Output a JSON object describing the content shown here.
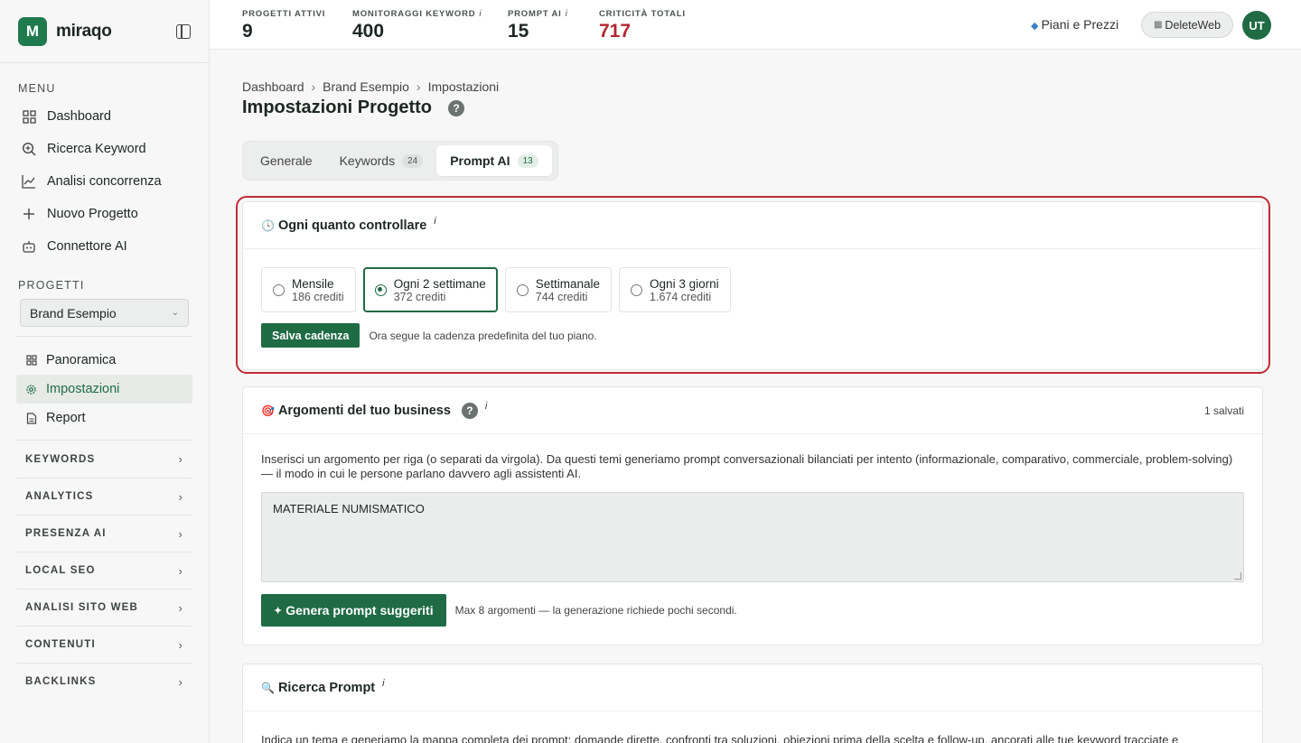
{
  "brand": {
    "logo_letter": "M",
    "name": "miraqo"
  },
  "sidebar": {
    "menu_title": "MENU",
    "menu": [
      {
        "label": "Dashboard",
        "icon": "grid-icon"
      },
      {
        "label": "Ricerca Keyword",
        "icon": "search-plus-icon"
      },
      {
        "label": "Analisi concorrenza",
        "icon": "chart-line-icon"
      },
      {
        "label": "Nuovo Progetto",
        "icon": "plus-icon"
      },
      {
        "label": "Connettore AI",
        "icon": "robot-icon"
      }
    ],
    "projects_title": "PROGETTI",
    "project_select": "Brand Esempio",
    "project_nav": [
      {
        "label": "Panoramica",
        "icon": "grid-small-icon"
      },
      {
        "label": "Impostazioni",
        "icon": "gear-icon",
        "active": true
      },
      {
        "label": "Report",
        "icon": "document-icon"
      }
    ],
    "groups": [
      "KEYWORDS",
      "ANALYTICS",
      "PRESENZA AI",
      "LOCAL SEO",
      "ANALISI SITO WEB",
      "CONTENUTI",
      "BACKLINKS"
    ]
  },
  "topbar": {
    "stats": [
      {
        "label": "PROGETTI ATTIVI",
        "value": "9",
        "info": ""
      },
      {
        "label": "MONITORAGGI KEYWORD",
        "value": "400",
        "info": "i"
      },
      {
        "label": "PROMPT AI",
        "value": "15",
        "info": "i"
      },
      {
        "label": "CRITICITÀ TOTALI",
        "value": "717",
        "info": ""
      }
    ],
    "pricing": "Piani e Prezzi",
    "workspace": "DeleteWeb",
    "avatar": "UT",
    "colors": {
      "accent": "#1f6b44",
      "critical": "#b3262e"
    }
  },
  "breadcrumb": [
    "Dashboard",
    "Brand Esempio",
    "Impostazioni"
  ],
  "page_title": "Impostazioni Progetto",
  "tabs": [
    {
      "label": "Generale",
      "count": ""
    },
    {
      "label": "Keywords",
      "count": "24"
    },
    {
      "label": "Prompt AI",
      "count": "13",
      "active": true
    }
  ],
  "cadence": {
    "title": "Ogni quanto controllare",
    "info": "i",
    "options": [
      {
        "name": "Mensile",
        "credits": "186 crediti"
      },
      {
        "name": "Ogni 2 settimane",
        "credits": "372 crediti",
        "selected": true
      },
      {
        "name": "Settimanale",
        "credits": "744 crediti"
      },
      {
        "name": "Ogni 3 giorni",
        "credits": "1.674 crediti"
      }
    ],
    "save_label": "Salva cadenza",
    "note": "Ora segue la cadenza predefinita del tuo piano."
  },
  "topics": {
    "title": "Argomenti del tuo business",
    "info": "i",
    "saved": "1 salvati",
    "description": "Inserisci un argomento per riga (o separati da virgola). Da questi temi generiamo prompt conversazionali bilanciati per intento (informazionale, comparativo, commerciale, problem-solving) — il modo in cui le persone parlano davvero agli assistenti AI.",
    "textarea_value": "MATERIALE NUMISMATICO",
    "generate_label": "Genera prompt suggeriti",
    "generate_note": "Max 8 argomenti — la generazione richiede pochi secondi."
  },
  "research": {
    "title": "Ricerca Prompt",
    "info": "i",
    "description": "Indica un tema e generiamo la mappa completa dei prompt: domande dirette, confronti tra soluzioni, obiezioni prima della scelta e follow-up, ancorati alle tue keyword tracciate e"
  }
}
